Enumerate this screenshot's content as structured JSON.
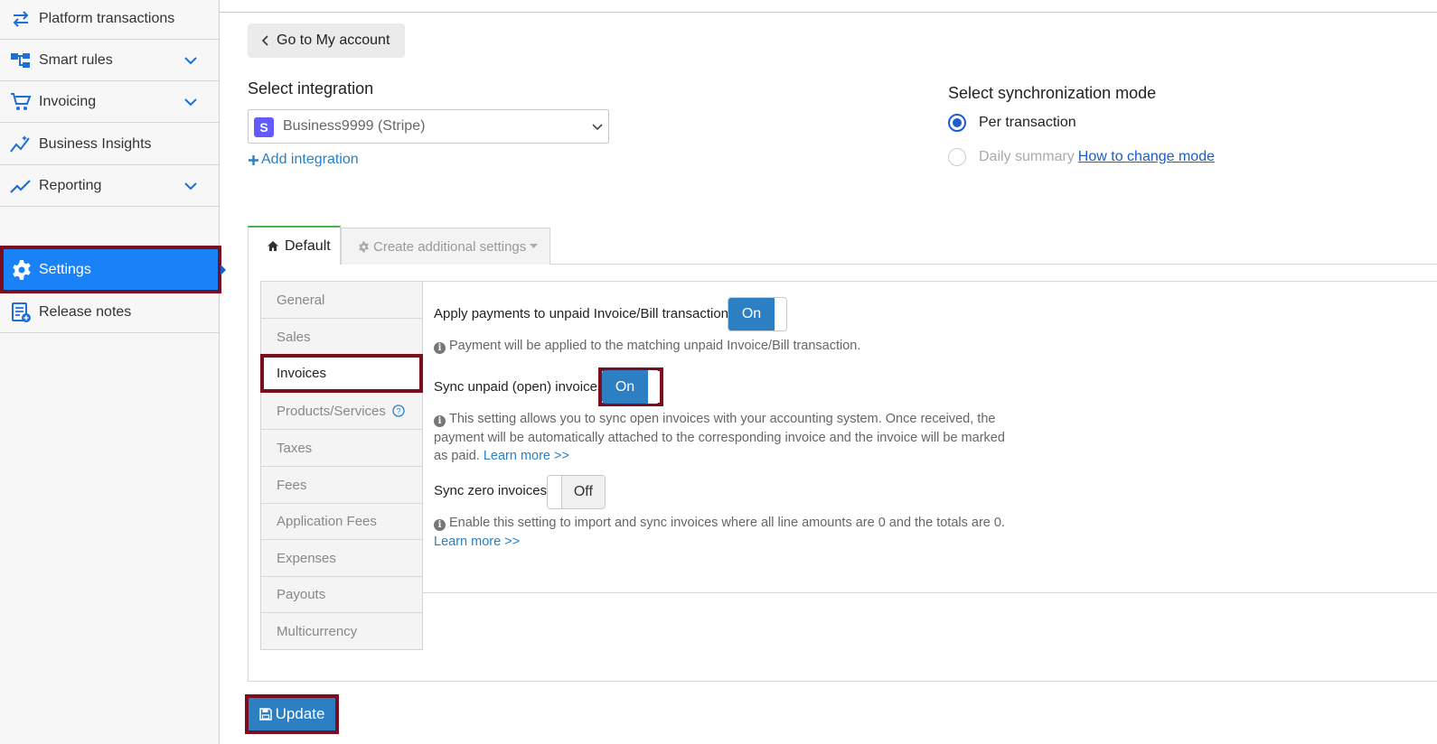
{
  "sidebar": {
    "items": [
      {
        "label": "Platform transactions",
        "icon": "transfer-arrows-icon",
        "has_chevron": false
      },
      {
        "label": "Smart rules",
        "icon": "hierarchy-icon",
        "has_chevron": true
      },
      {
        "label": "Invoicing",
        "icon": "cart-icon",
        "has_chevron": true
      },
      {
        "label": "Business Insights",
        "icon": "insights-chart-icon",
        "has_chevron": false
      },
      {
        "label": "Reporting",
        "icon": "trend-line-icon",
        "has_chevron": true
      },
      {
        "label": "Settings",
        "icon": "gear-icon",
        "active": true
      },
      {
        "label": "Release notes",
        "icon": "release-notes-icon"
      }
    ]
  },
  "header": {
    "back_label": "Go to My account"
  },
  "integration": {
    "heading": "Select integration",
    "selected": "Business9999 (Stripe)",
    "logo_letter": "S",
    "add_label": "Add integration"
  },
  "sync_mode": {
    "heading": "Select synchronization mode",
    "options": [
      {
        "label": "Per transaction",
        "selected": true
      },
      {
        "label": "Daily summary",
        "selected": false
      }
    ],
    "help_link": "How to change mode"
  },
  "tabs": {
    "default_label": "Default",
    "additional_label": "Create additional settings"
  },
  "subnav": {
    "items": [
      "General",
      "Sales",
      "Invoices",
      "Products/Services",
      "Taxes",
      "Fees",
      "Application Fees",
      "Expenses",
      "Payouts",
      "Multicurrency"
    ],
    "active": "Invoices"
  },
  "settings": {
    "apply_payments": {
      "label": "Apply payments to unpaid Invoice/Bill transactions",
      "state": "On",
      "help": "Payment will be applied to the matching unpaid Invoice/Bill transaction."
    },
    "sync_unpaid": {
      "label": "Sync unpaid (open) invoices",
      "state": "On",
      "help": "This setting allows you to sync open invoices with your accounting system. Once received, the payment will be automatically attached to the corresponding invoice and the invoice will be marked as paid.",
      "link": "Learn more >>"
    },
    "sync_zero": {
      "label": "Sync zero invoices",
      "state": "Off",
      "help": "Enable this setting to import and sync invoices where all line amounts are 0 and the totals are 0.",
      "link": "Learn more >>"
    }
  },
  "footer": {
    "update_label": "Update"
  },
  "colors": {
    "accent": "#2b7fc2",
    "sidebar_active": "#1a82f7",
    "highlight_border": "#7a0e1e"
  }
}
